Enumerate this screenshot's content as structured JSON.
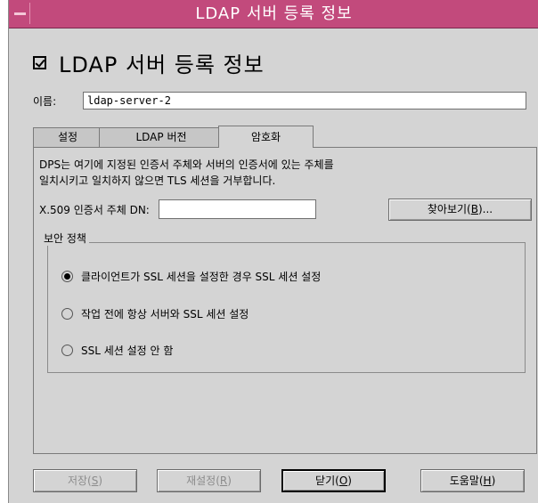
{
  "window": {
    "title": "LDAP 서버 등록 정보"
  },
  "header": {
    "title": "LDAP 서버 등록 정보"
  },
  "name": {
    "label": "이름:",
    "value": "ldap-server-2"
  },
  "tabs": [
    {
      "label": "설정"
    },
    {
      "label": "LDAP 버전"
    },
    {
      "label": "암호화"
    }
  ],
  "active_tab": "암호화",
  "encryption": {
    "description_line1": "DPS는 여기에 지정된 인증서 주체와 서버의 인증서에 있는 주체를",
    "description_line2": "일치시키고 일치하지 않으면 TLS 세션을 거부합니다.",
    "x509_label": "X.509 인증서 주체 DN:",
    "x509_value": "",
    "browse_label": "찾아보기(",
    "browse_mnemonic": "B",
    "browse_suffix": ")..."
  },
  "security_policy": {
    "title": "보안 정책",
    "options": [
      {
        "label": "클라이언트가 SSL 세션을 설정한 경우 SSL 세션 설정",
        "selected": true
      },
      {
        "label": "작업 전에 항상 서버와 SSL 세션 설정",
        "selected": false
      },
      {
        "label": "SSL 세션 설정 안 함",
        "selected": false
      }
    ]
  },
  "buttons": {
    "save": {
      "label": "저장(",
      "mnemonic": "S",
      "suffix": ")"
    },
    "reset": {
      "label": "재설정(",
      "mnemonic": "R",
      "suffix": ")"
    },
    "close": {
      "label": "닫기(",
      "mnemonic": "O",
      "suffix": ")"
    },
    "help": {
      "label": "도움말(",
      "mnemonic": "H",
      "suffix": ")"
    }
  },
  "colors": {
    "titlebar": "#c24a7c",
    "background": "#d4d4d4"
  }
}
